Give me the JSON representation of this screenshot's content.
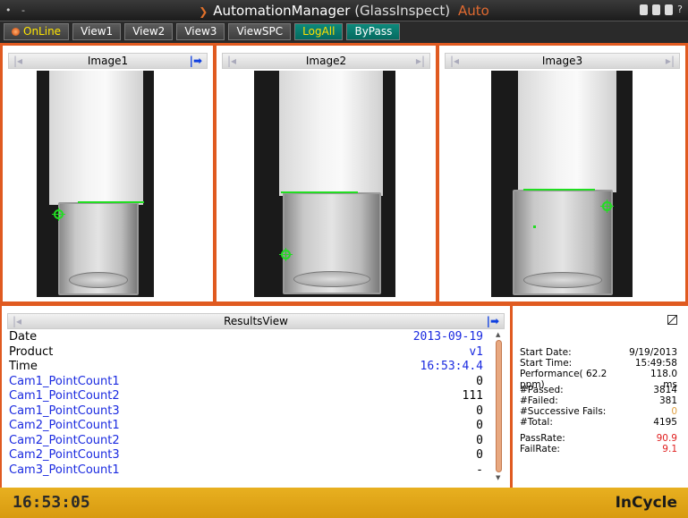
{
  "titlebar": {
    "app_name": "AutomationManager",
    "context": "(GlassInspect)",
    "mode": "Auto",
    "help_label": "?"
  },
  "toolbar": {
    "buttons": [
      {
        "label": "OnLine"
      },
      {
        "label": "View1"
      },
      {
        "label": "View2"
      },
      {
        "label": "View3"
      },
      {
        "label": "ViewSPC"
      },
      {
        "label": "LogAll"
      },
      {
        "label": "ByPass"
      }
    ]
  },
  "images": [
    {
      "label": "Image1"
    },
    {
      "label": "Image2"
    },
    {
      "label": "Image3"
    }
  ],
  "results": {
    "title": "ResultsView",
    "rows": [
      {
        "key": "Date",
        "value": "2013-09-19"
      },
      {
        "key": "Product",
        "value": "v1"
      },
      {
        "key": "Time",
        "value": "16:53:4.4"
      },
      {
        "key": "Cam1_PointCount1",
        "value": "0"
      },
      {
        "key": "Cam1_PointCount2",
        "value": "111"
      },
      {
        "key": "Cam1_PointCount3",
        "value": "0"
      },
      {
        "key": "Cam2_PointCount1",
        "value": "0"
      },
      {
        "key": "Cam2_PointCount2",
        "value": "0"
      },
      {
        "key": "Cam2_PointCount3",
        "value": "0"
      },
      {
        "key": "Cam3_PointCount1",
        "value": "-"
      }
    ]
  },
  "stats": {
    "start_date_label": "Start Date:",
    "start_date": "9/19/2013",
    "start_time_label": "Start Time:",
    "start_time": "15:49:58",
    "performance_label": "Performance( 62.2 ppm)",
    "performance": "118.0 ms",
    "passed_label": "#Passed:",
    "passed": "3814",
    "failed_label": "#Failed:",
    "failed": "381",
    "successive_label": "#Successive Fails:",
    "successive": "0",
    "total_label": "#Total:",
    "total": "4195",
    "passrate_label": "PassRate:",
    "passrate": "90.9",
    "failrate_label": "FailRate:",
    "failrate": "9.1"
  },
  "statusbar": {
    "clock": "16:53:05",
    "state": "InCycle"
  },
  "colors": {
    "accent_orange": "#e05a20",
    "status_yellow": "#e8b020",
    "link_blue": "#1a2ae0",
    "rate_red": "#e02020",
    "indicator_green": "#22dd22"
  }
}
